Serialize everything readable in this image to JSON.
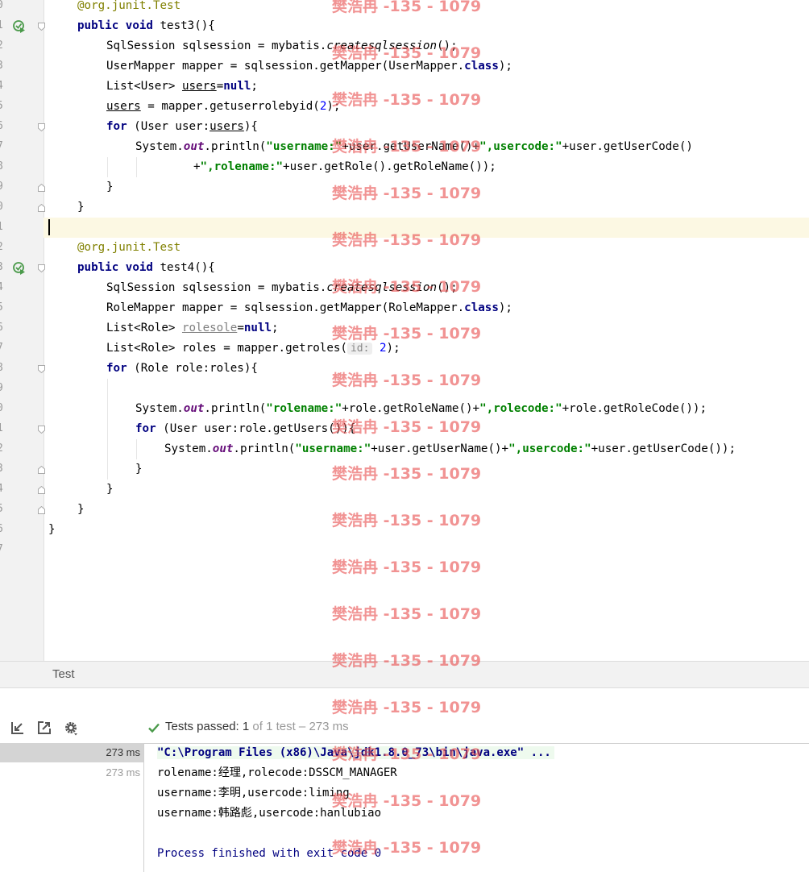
{
  "editor": {
    "line_numbers": [
      "0",
      "1",
      "2",
      "3",
      "4",
      "5",
      "6",
      "7",
      "8",
      "9",
      "0",
      "1",
      "2",
      "3",
      "4",
      "5",
      "6",
      "7",
      "8",
      "9",
      "0",
      "1",
      "2",
      "3",
      "4",
      "5",
      "6",
      "7"
    ],
    "lines": {
      "l0_ann": "@org.junit.Test",
      "l1_kw": "public void",
      "l1_rest": " test3(){",
      "l2_a": "SqlSession sqlsession = mybatis.",
      "l2_b": "createsqlsession",
      "l2_c": "();",
      "l3_a": "UserMapper mapper = sqlsession.getMapper(UserMapper.",
      "l3_kw": "class",
      "l3_c": ");",
      "l4_a": "List<User> ",
      "l4_var": "users",
      "l4_b": "=",
      "l4_kw": "null",
      "l4_c": ";",
      "l5_var": "users",
      "l5_a": " = mapper.getuserrolebyid(",
      "l5_num": "2",
      "l5_c": ");",
      "l6_kw": "for",
      "l6_a": " (User user:",
      "l6_var": "users",
      "l6_c": "){",
      "l7_a": "System.",
      "l7_fld": "out",
      "l7_b": ".println(",
      "l7_s1": "\"username:\"",
      "l7_c": "+user.getUserName()+",
      "l7_s2": "\",usercode:\"",
      "l7_d": "+user.getUserCode()",
      "l8_a": "+",
      "l8_s1": "\",rolename:\"",
      "l8_b": "+user.getRole().getRoleName());",
      "l9": "}",
      "l10": "}",
      "l12_ann": "@org.junit.Test",
      "l13_kw": "public void",
      "l13_rest": " test4(){",
      "l14_a": "SqlSession sqlsession = mybatis.",
      "l14_b": "createsqlsession",
      "l14_c": "();",
      "l15_a": "RoleMapper mapper = sqlsession.getMapper(RoleMapper.",
      "l15_kw": "class",
      "l15_c": ");",
      "l16_a": "List<Role> ",
      "l16_var": "rolesole",
      "l16_b": "=",
      "l16_kw": "null",
      "l16_c": ";",
      "l17_a": "List<Role> roles = mapper.getroles(",
      "l17_hint": "id:",
      "l17_num": "2",
      "l17_c": ");",
      "l18_kw": "for",
      "l18_a": " (Role role:roles){",
      "l20_a": "System.",
      "l20_fld": "out",
      "l20_b": ".println(",
      "l20_s1": "\"rolename:\"",
      "l20_c": "+role.getRoleName()+",
      "l20_s2": "\",rolecode:\"",
      "l20_d": "+role.getRoleCode());",
      "l21_kw": "for",
      "l21_a": " (User user:role.getUsers()){",
      "l22_a": "System.",
      "l22_fld": "out",
      "l22_b": ".println(",
      "l22_s1": "\"username:\"",
      "l22_c": "+user.getUserName()+",
      "l22_s2": "\",usercode:\"",
      "l22_d": "+user.getUserCode());",
      "l23": "}",
      "l24": "}",
      "l25": "}",
      "l26": "}"
    }
  },
  "tool_window": {
    "title": "Test"
  },
  "toolbar": {
    "status_strong": "Tests passed: 1",
    "status_dim": " of 1 test – 273 ms",
    "icons": [
      "import-tests-icon",
      "export-tests-icon",
      "settings-gear-icon",
      "check-icon"
    ]
  },
  "results": {
    "rows": [
      {
        "time": "273 ms"
      },
      {
        "time": "273 ms"
      }
    ]
  },
  "console": {
    "lines": [
      "\"C:\\Program Files (x86)\\Java\\jdk1.8.0_73\\bin\\java.exe\" ...",
      "rolename:经理,rolecode:DSSCM_MANAGER",
      "username:李明,usercode:liming",
      "username:韩路彪,usercode:hanlubiao",
      "",
      "Process finished with exit code 0"
    ]
  },
  "watermark": {
    "text": "樊浩冉 -135 - 1079"
  },
  "colors": {
    "keyword": "#000080",
    "annotation": "#808000",
    "string": "#008000",
    "number": "#0000ff",
    "static_field": "#660e7a",
    "current_line": "#fcf8e3",
    "watermark": "#e85050",
    "passed": "#4a9a4a"
  }
}
